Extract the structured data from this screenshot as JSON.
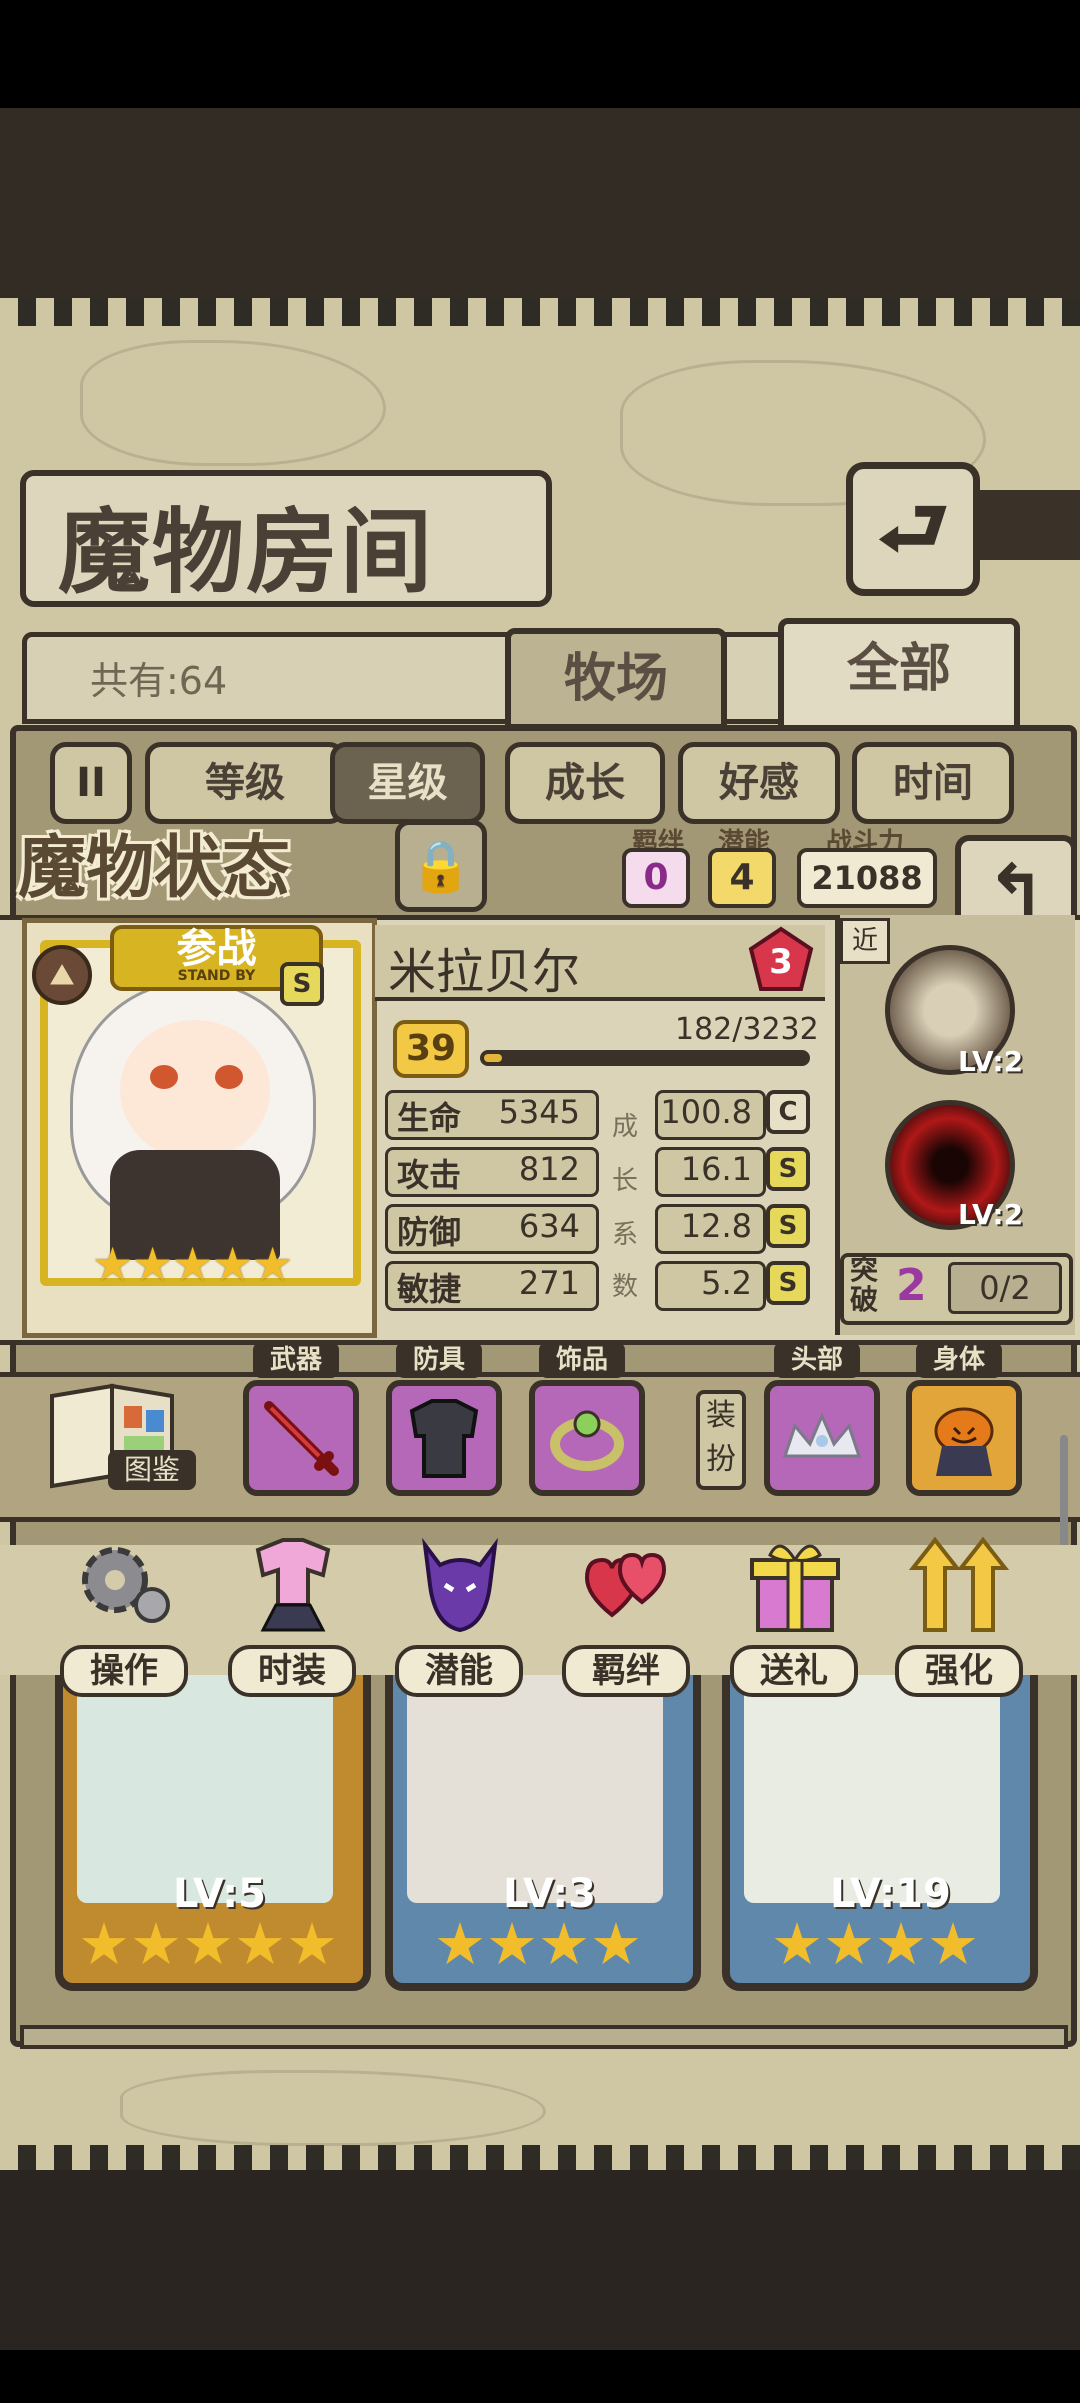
{
  "header": {
    "title": "魔物房间",
    "back_glyph": "⮐"
  },
  "list": {
    "count_label": "共有:64",
    "tabs": [
      {
        "label": "牧场"
      },
      {
        "label": "全部"
      }
    ],
    "sort_buttons": [
      "等级",
      "星级",
      "成长",
      "好感",
      "时间"
    ],
    "pause_glyph": "II"
  },
  "status": {
    "title": "魔物状态",
    "bond_label": "羁绊",
    "bond_value": "0",
    "potential_label": "潜能",
    "potential_value": "4",
    "power_label": "战斗力",
    "power_value": "21088"
  },
  "monster": {
    "name": "米拉贝尔",
    "rank_gem": "3",
    "standby_label": "参战",
    "standby_sub": "STAND BY",
    "grade": "S",
    "stars": 5,
    "level": "39",
    "exp": "182/3232",
    "exp_fraction": 0.056,
    "stats": [
      {
        "name": "生命",
        "value": "5345",
        "growth": "100.8",
        "grade": "C"
      },
      {
        "name": "攻击",
        "value": "812",
        "growth": "16.1",
        "grade": "S"
      },
      {
        "name": "防御",
        "value": "634",
        "growth": "12.8",
        "grade": "S"
      },
      {
        "name": "敏捷",
        "value": "271",
        "growth": "5.2",
        "grade": "S"
      }
    ],
    "growth_label": [
      "成",
      "长",
      "系",
      "数"
    ]
  },
  "skills": {
    "range_tag": "近",
    "items": [
      {
        "level": "LV:2"
      },
      {
        "level": "LV:2"
      }
    ],
    "breakthrough_label_1": "突",
    "breakthrough_label_2": "破",
    "breakthrough_value": "2",
    "breakthrough_progress": "0/2"
  },
  "equipment": {
    "codex_label": "图鉴",
    "slots": [
      {
        "label": "武器"
      },
      {
        "label": "防具"
      },
      {
        "label": "饰品"
      }
    ],
    "dress_label_1": "装",
    "dress_label_2": "扮",
    "appearance": [
      {
        "label": "头部"
      },
      {
        "label": "身体"
      }
    ]
  },
  "actions": [
    {
      "label": "操作",
      "icon": "gear-icon"
    },
    {
      "label": "时装",
      "icon": "outfit-icon"
    },
    {
      "label": "潜能",
      "icon": "demon-icon"
    },
    {
      "label": "羁绊",
      "icon": "hearts-icon"
    },
    {
      "label": "送礼",
      "icon": "gift-icon"
    },
    {
      "label": "强化",
      "icon": "upgrade-arrows-icon"
    }
  ],
  "cards": [
    {
      "level": "LV:5",
      "stars": 5,
      "frame": "#c08a2e"
    },
    {
      "level": "LV:3",
      "stars": 4,
      "frame": "#5f88aa"
    },
    {
      "level": "LV:19",
      "stars": 4,
      "frame": "#5f88aa"
    }
  ]
}
